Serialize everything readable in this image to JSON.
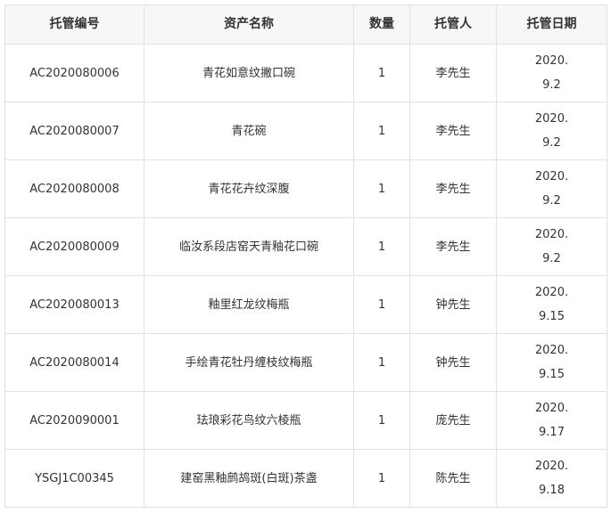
{
  "table": {
    "headers": [
      "托管编号",
      "资产名称",
      "数量",
      "托管人",
      "托管日期"
    ],
    "rows": [
      {
        "id": "AC2020080006",
        "name": "青花如意纹撇口碗",
        "qty": "1",
        "custodian": "李先生",
        "date_year": "2020.",
        "date_day": "9.2"
      },
      {
        "id": "AC2020080007",
        "name": "青花碗",
        "qty": "1",
        "custodian": "李先生",
        "date_year": "2020.",
        "date_day": "9.2"
      },
      {
        "id": "AC2020080008",
        "name": "青花花卉纹深腹",
        "qty": "1",
        "custodian": "李先生",
        "date_year": "2020.",
        "date_day": "9.2"
      },
      {
        "id": "AC2020080009",
        "name": "临汝系段店窑天青釉花口碗",
        "qty": "1",
        "custodian": "李先生",
        "date_year": "2020.",
        "date_day": "9.2"
      },
      {
        "id": "AC2020080013",
        "name": "釉里红龙纹梅瓶",
        "qty": "1",
        "custodian": "钟先生",
        "date_year": "2020.",
        "date_day": "9.15"
      },
      {
        "id": "AC2020080014",
        "name": "手绘青花牡丹缠枝纹梅瓶",
        "qty": "1",
        "custodian": "钟先生",
        "date_year": "2020.",
        "date_day": "9.15"
      },
      {
        "id": "AC2020090001",
        "name": "珐琅彩花鸟纹六棱瓶",
        "qty": "1",
        "custodian": "庞先生",
        "date_year": "2020.",
        "date_day": "9.17"
      },
      {
        "id": "YSGJ1C00345",
        "name": "建窑黑釉鹧鸪斑(白斑)茶盏",
        "qty": "1",
        "custodian": "陈先生",
        "date_year": "2020.",
        "date_day": "9.18"
      }
    ]
  }
}
